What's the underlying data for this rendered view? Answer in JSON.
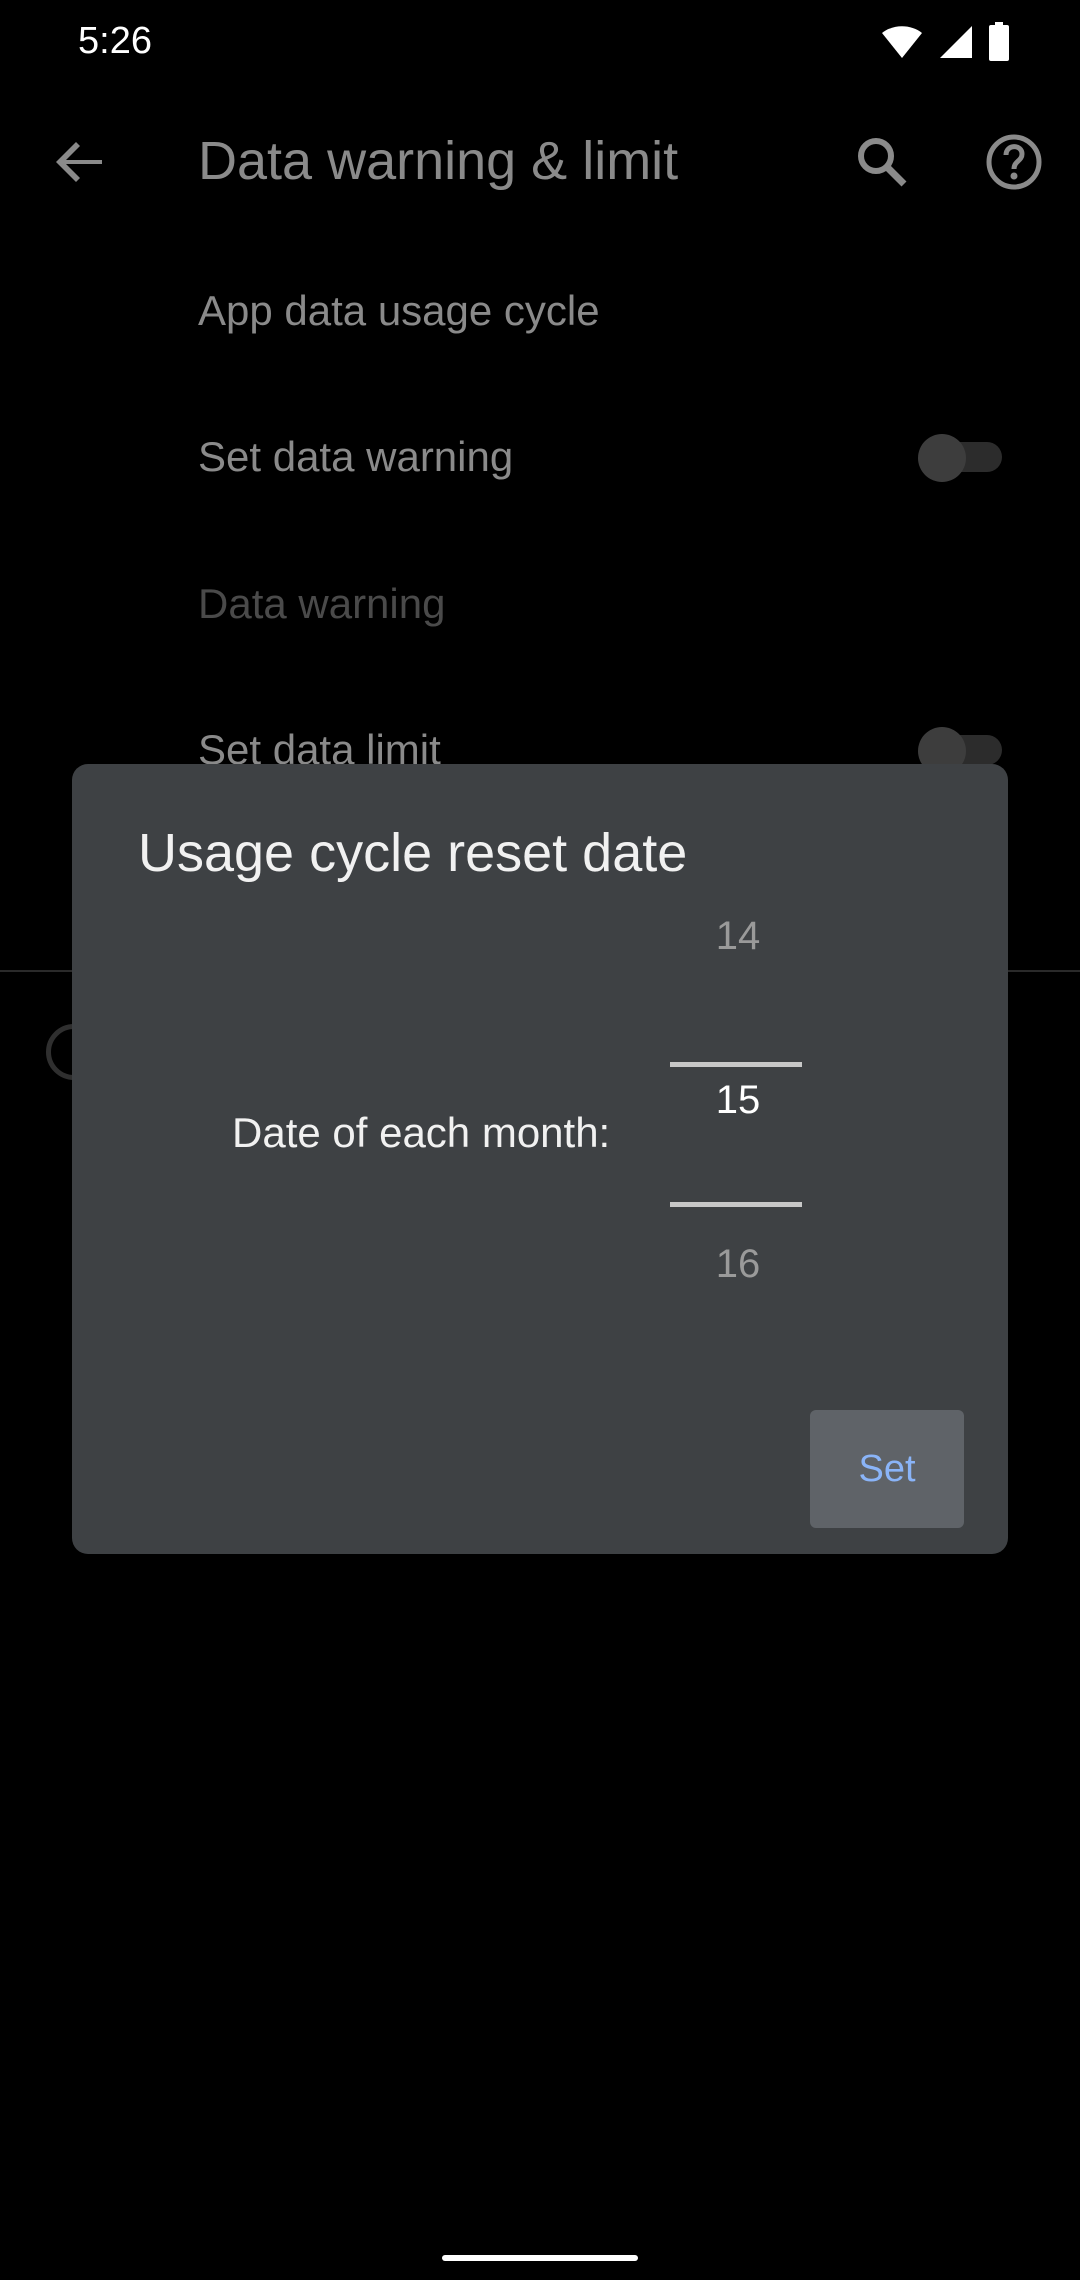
{
  "status_bar": {
    "time": "5:26",
    "icons": [
      "wifi-icon",
      "cellular-signal-icon",
      "battery-icon"
    ]
  },
  "app_bar": {
    "title": "Data warning & limit",
    "back_icon": "arrow-back-icon",
    "search_icon": "search-icon",
    "help_icon": "help-icon"
  },
  "settings": {
    "items": [
      {
        "label": "App data usage cycle"
      },
      {
        "label": "Set data warning",
        "toggle": false
      },
      {
        "label": "Data warning",
        "disabled": true
      },
      {
        "label": "Set data limit",
        "toggle": false
      }
    ]
  },
  "dialog": {
    "title": "Usage cycle reset date",
    "picker_label": "Date of each month:",
    "picker": {
      "previous": "14",
      "selected": "15",
      "next": "16"
    },
    "set_label": "Set"
  },
  "colors": {
    "background": "#000000",
    "dialog": "#3e4144",
    "accent": "#8ab4f8",
    "button": "#5f6368"
  }
}
